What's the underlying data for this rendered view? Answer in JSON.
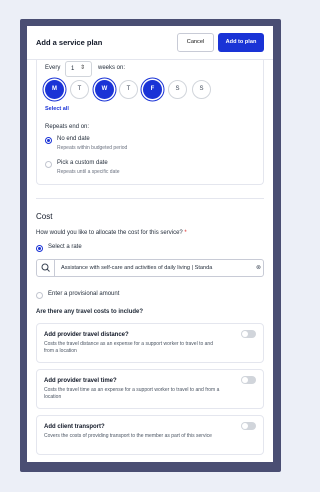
{
  "header": {
    "title": "Add a service plan",
    "cancel_label": "Cancel",
    "add_label": "Add to plan"
  },
  "schedule": {
    "every_label": "Every",
    "interval_value": "1",
    "weeks_label": "weeks on:",
    "days": [
      {
        "label": "M",
        "selected": true
      },
      {
        "label": "T",
        "selected": false
      },
      {
        "label": "W",
        "selected": true
      },
      {
        "label": "T",
        "selected": false
      },
      {
        "label": "F",
        "selected": true
      },
      {
        "label": "S",
        "selected": false
      },
      {
        "label": "S",
        "selected": false
      }
    ],
    "select_all_label": "Select all",
    "repeats_end_label": "Repeats end on:",
    "end_options": [
      {
        "label": "No end date",
        "hint": "Repeats within budgeted period",
        "selected": true
      },
      {
        "label": "Pick a custom date",
        "hint": "Repeats until a specific date",
        "selected": false
      }
    ]
  },
  "cost": {
    "heading": "Cost",
    "allocate_question": "How would you like to allocate the cost for this service?",
    "required_mark": "*",
    "select_rate_label": "Select a rate",
    "rate_value": "Assistance with self-care and activities of daily living | Standa",
    "provisional_label": "Enter a provisional amount",
    "travel_question": "Are there any travel costs to include?"
  },
  "travel_options": [
    {
      "title": "Add provider travel distance?",
      "description": "Costs the travel distance as an expense for a support worker to travel to and from a location",
      "enabled": false
    },
    {
      "title": "Add provider travel time?",
      "description": "Costs the travel time as an expense for a support worker to travel to and from a location",
      "enabled": false
    },
    {
      "title": "Add client transport?",
      "description": "Covers the costs of providing transport to the member as part of this service",
      "enabled": false
    }
  ],
  "icons": {
    "stepper": "stepper-icon",
    "search": "search-icon",
    "clear": "clear-icon"
  },
  "colors": {
    "accent": "#1a33d6",
    "frame": "#4a4e73",
    "required": "#dc2626"
  }
}
